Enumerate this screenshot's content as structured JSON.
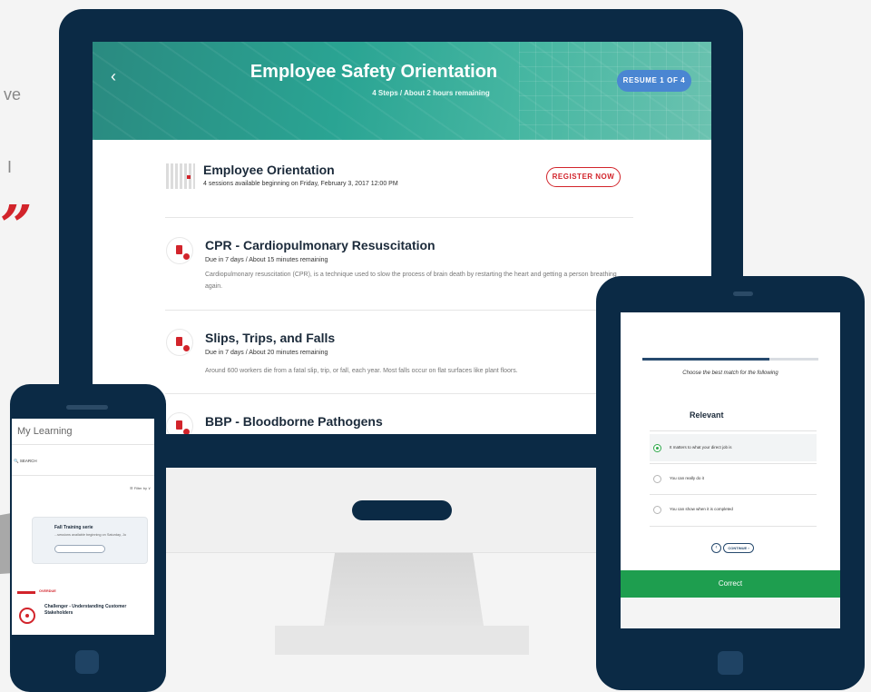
{
  "background_fragments": {
    "top": "ve",
    "mid": "I",
    "quote": "”"
  },
  "colors": {
    "navy": "#0b2a45",
    "accent_red": "#d2242b",
    "teal": "#2aa493",
    "blue": "#4a86d2",
    "green": "#1e9e4f"
  },
  "desktop": {
    "header": {
      "back_icon": "‹",
      "title": "Employee Safety Orientation",
      "subtitle": "4 Steps  /  About 2 hours remaining",
      "resume_label": "RESUME 1 OF 4"
    },
    "orientation": {
      "title": "Employee Orientation",
      "sessions": "4 sessions available beginning on Friday, February 3, 2017 12:00 PM",
      "register_label": "REGISTER NOW"
    },
    "courses": [
      {
        "title": "CPR - Cardiopulmonary Resuscitation",
        "meta": "Due in 7 days  /  About 15 minutes remaining",
        "desc": "Cardiopulmonary resuscitation (CPR), is a technique used to slow the process of brain death by restarting the heart and getting a person breathing again."
      },
      {
        "title": "Slips, Trips, and Falls",
        "meta": "Due in 7 days  /  About 20 minutes remaining",
        "desc": "Around 600 workers die from a fatal slip, trip, or fall, each year. Most falls occur on flat surfaces like plant floors."
      },
      {
        "title": "BBP - Bloodborne Pathogens",
        "meta": "",
        "desc": ""
      }
    ]
  },
  "tablet": {
    "progress_fraction": 0.72,
    "prompt": "Choose the best match for the following",
    "question": "Relevant",
    "options": [
      {
        "label": "It matters to what your direct job is",
        "selected": true
      },
      {
        "label": "You can really do it",
        "selected": false
      },
      {
        "label": "You can show when it is completed",
        "selected": false
      }
    ],
    "back_symbol": "‹",
    "continue_label": "CONTINUE ›",
    "result": "Correct"
  },
  "phone": {
    "title": "My Learning",
    "search_label": "🔍 SEARCH",
    "filter_label": "☰ Filter by  ∨",
    "card_title": "Fall Training serie",
    "card_sub": "...sessions available beginning on Saturday, Ju",
    "overdue_label": "OVERDUE",
    "course_title": "Challenger - Understanding Customer Stakeholders"
  }
}
